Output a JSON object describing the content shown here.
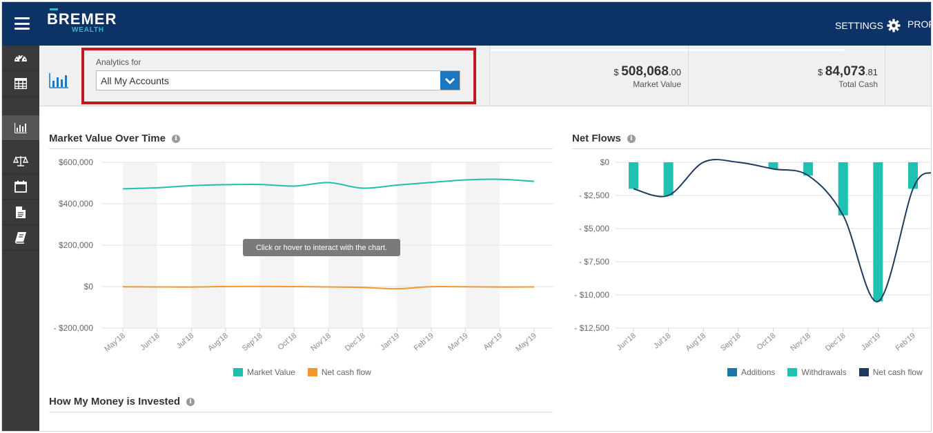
{
  "header": {
    "brand": "BREMER",
    "brand_sub": "WEALTH",
    "settings_label": "SETTINGS",
    "profile_label": "PROFI",
    "colors": {
      "navy": "#0d3266",
      "teal": "#1fb5ad"
    }
  },
  "sidebar": {
    "items": [
      {
        "icon": "dashboard-icon"
      },
      {
        "icon": "grid-icon"
      },
      {
        "icon": "bar-chart-icon",
        "active": true
      },
      {
        "icon": "scale-icon"
      },
      {
        "icon": "calendar-icon"
      },
      {
        "icon": "document-icon"
      },
      {
        "icon": "book-icon"
      }
    ]
  },
  "analytics": {
    "label": "Analytics for",
    "selected": "All My Accounts",
    "highlight_color": "#c0171e"
  },
  "stats": [
    {
      "currency": "$",
      "whole": "508,068",
      "cents": ".00",
      "label": "Market Value"
    },
    {
      "currency": "$",
      "whole": "84,073",
      "cents": ".81",
      "label": "Total Cash"
    }
  ],
  "market_panel": {
    "title": "Market Value Over Time",
    "tooltip": "Click or hover to interact with the chart.",
    "legend": [
      {
        "label": "Market Value",
        "color": "#1fbfae"
      },
      {
        "label": "Net cash flow",
        "color": "#f5952a"
      }
    ]
  },
  "netflows_panel": {
    "title": "Net Flows",
    "legend": [
      {
        "label": "Additions",
        "color": "#1a78a8"
      },
      {
        "label": "Withdrawals",
        "color": "#1fc1b3"
      },
      {
        "label": "Net cash flow",
        "color": "#1d3a5e"
      }
    ]
  },
  "invested_panel": {
    "title": "How My Money is Invested"
  },
  "chart_data": [
    {
      "type": "line",
      "title": "Market Value Over Time",
      "categories": [
        "May'18",
        "Jun'18",
        "Jul'18",
        "Aug'18",
        "Sep'18",
        "Oct'18",
        "Nov'18",
        "Dec'18",
        "Jan'19",
        "Feb'19",
        "Mar'19",
        "Apr'19",
        "May'19"
      ],
      "y_ticks": [
        "$600,000",
        "$400,000",
        "$200,000",
        "$0",
        "- $200,000"
      ],
      "ylim": [
        -200000,
        600000
      ],
      "series": [
        {
          "name": "Market Value",
          "color": "#1fbfae",
          "values": [
            472000,
            477000,
            487000,
            492000,
            493000,
            485000,
            502000,
            475000,
            490000,
            503000,
            515000,
            518000,
            508000
          ]
        },
        {
          "name": "Net cash flow",
          "color": "#f5952a",
          "values": [
            -1000,
            -1500,
            -2000,
            500,
            1000,
            0,
            -1500,
            -4000,
            -10500,
            -500,
            -1000,
            -2000,
            -1500
          ]
        }
      ],
      "legend_position": "bottom-center",
      "grid": true
    },
    {
      "type": "bar",
      "title": "Net Flows",
      "categories": [
        "Jun'18",
        "Jul'18",
        "Aug'18",
        "Sep'18",
        "Oct'18",
        "Nov'18",
        "Dec'18",
        "Jan'19",
        "Feb'19"
      ],
      "y_ticks": [
        "$0",
        "- $2,500",
        "- $5,000",
        "- $7,500",
        "- $10,000",
        "- $12,500"
      ],
      "ylim": [
        -12500,
        0
      ],
      "series": [
        {
          "name": "Additions",
          "color": "#1a78a8",
          "values": [
            0,
            0,
            0,
            0,
            0,
            0,
            0,
            0,
            0
          ]
        },
        {
          "name": "Withdrawals",
          "color": "#1fc1b3",
          "values": [
            -2000,
            -2500,
            0,
            0,
            -500,
            -1000,
            -4000,
            -10500,
            -2000
          ]
        },
        {
          "name": "Net cash flow",
          "color": "#1d3a5e",
          "type": "line",
          "values": [
            -2000,
            -2500,
            0,
            0,
            -500,
            -1000,
            -4000,
            -10500,
            -2000
          ]
        }
      ],
      "legend_position": "bottom-right",
      "grid": true
    }
  ]
}
